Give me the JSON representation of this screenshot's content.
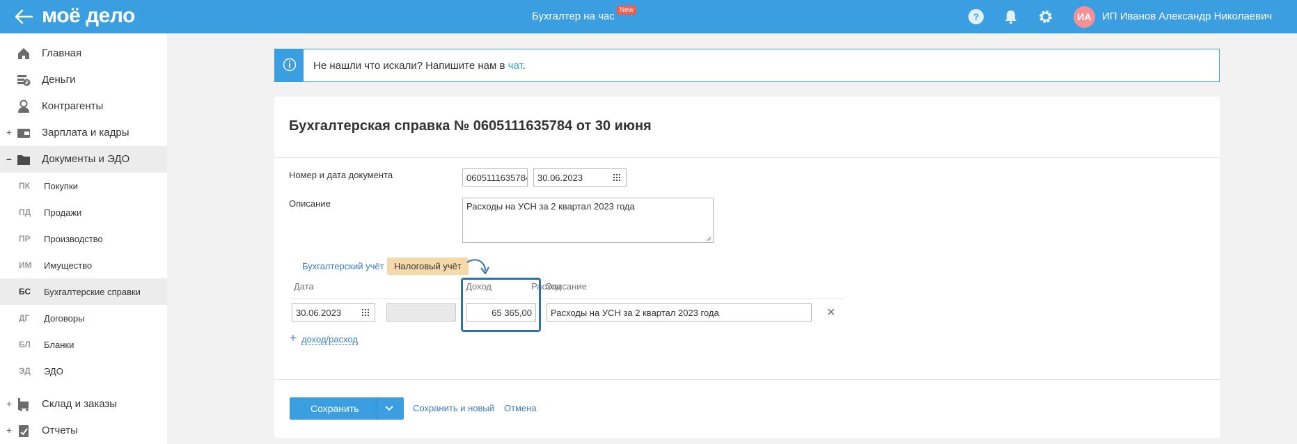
{
  "header": {
    "logo": "моё дело",
    "center_title": "Бухгалтер на час",
    "new_badge": "New",
    "avatar_initials": "ИА",
    "user_name": "ИП Иванов Александр Николаевич"
  },
  "sidebar": {
    "items": [
      {
        "label": "Главная",
        "icon": "home-icon"
      },
      {
        "label": "Деньги",
        "icon": "money-icon"
      },
      {
        "label": "Контрагенты",
        "icon": "contractors-icon"
      },
      {
        "label": "Зарплата и кадры",
        "icon": "wallet-icon",
        "expand": "+"
      },
      {
        "label": "Документы и ЭДО",
        "icon": "folder-icon",
        "expand": "–"
      }
    ],
    "sub_items": [
      {
        "abbr": "ПК",
        "label": "Покупки"
      },
      {
        "abbr": "ПД",
        "label": "Продажи"
      },
      {
        "abbr": "ПР",
        "label": "Производство"
      },
      {
        "abbr": "ИМ",
        "label": "Имущество"
      },
      {
        "abbr": "БС",
        "label": "Бухгалтерские справки"
      },
      {
        "abbr": "ДГ",
        "label": "Договоры"
      },
      {
        "abbr": "БЛ",
        "label": "Бланки"
      },
      {
        "abbr": "ЭД",
        "label": "ЭДО"
      }
    ],
    "bottom_items": [
      {
        "label": "Склад и заказы",
        "icon": "warehouse-icon",
        "expand": "+"
      },
      {
        "label": "Отчеты",
        "icon": "reports-icon",
        "expand": "+"
      }
    ]
  },
  "banner": {
    "text": "Не нашли что искали? Напишите нам в ",
    "link": "чат",
    "suffix": "."
  },
  "document": {
    "title": "Бухгалтерская справка № 0605111635784 от 30 июня",
    "number_date_label": "Номер и дата документа",
    "number_value": "0605111635784",
    "date_value": "30.06.2023",
    "description_label": "Описание",
    "description_value": "Расходы на УСН за 2 квартал 2023 года"
  },
  "tabs": {
    "accounting": "Бухгалтерский учёт",
    "tax": "Налоговый учёт"
  },
  "table": {
    "headers": {
      "date": "Дата",
      "income": "Доход",
      "expense": "Расход",
      "description": "Описание"
    },
    "rows": [
      {
        "date": "30.06.2023",
        "income": "",
        "expense": "65 365,00",
        "description": "Расходы на УСН за 2 квартал 2023 года"
      }
    ],
    "add_link": "доход/расход"
  },
  "footer": {
    "save": "Сохранить",
    "save_and_new": "Сохранить и новый",
    "cancel": "Отмена"
  }
}
